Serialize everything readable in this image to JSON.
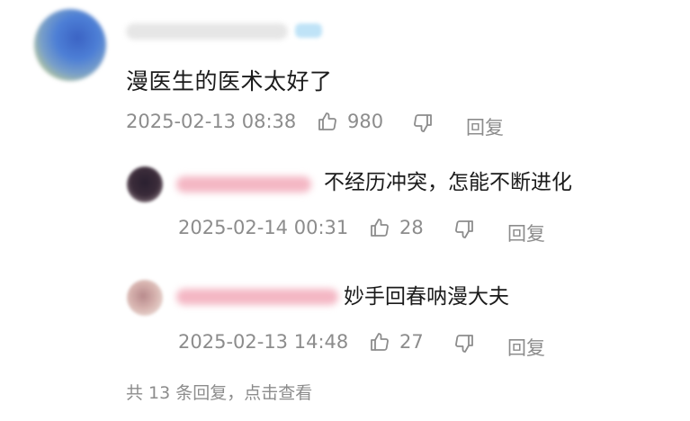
{
  "comment": {
    "text": "漫医生的医术太好了",
    "time": "2025-02-13 08:38",
    "likes": "980",
    "reply_label": "回复"
  },
  "replies": [
    {
      "text": "不经历冲突，怎能不断进化",
      "time": "2025-02-14 00:31",
      "likes": "28",
      "reply_label": "回复"
    },
    {
      "text": "妙手回春呐漫大夫",
      "time": "2025-02-13 14:48",
      "likes": "27",
      "reply_label": "回复"
    }
  ],
  "footer": {
    "text": "共 13 条回复，点击查看"
  },
  "colors": {
    "meta": "#8c8c8c",
    "text": "#1b1b1b",
    "name_blur": "#f4b7c4"
  }
}
